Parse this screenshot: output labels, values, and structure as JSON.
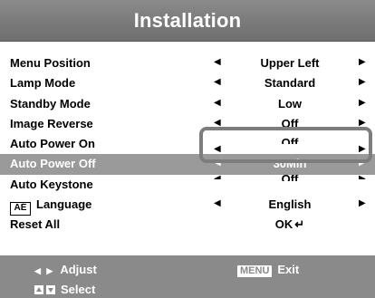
{
  "title": "Installation",
  "menu": {
    "items": [
      {
        "label": "Menu Position",
        "value": "Upper Left"
      },
      {
        "label": "Lamp Mode",
        "value": "Standard"
      },
      {
        "label": "Standby Mode",
        "value": "Low"
      },
      {
        "label": "Image Reverse",
        "value": "Off"
      },
      {
        "label": "Auto Power On",
        "value": "Off"
      },
      {
        "label": "Auto Power Off",
        "value": "30Min"
      },
      {
        "label": "Auto Keystone",
        "value": "Off"
      },
      {
        "label": "Language",
        "value": "English"
      },
      {
        "label": "Reset All",
        "value": "OK"
      }
    ],
    "language_icon_text": "AÉ"
  },
  "footer": {
    "adjust_label": "Adjust",
    "select_label": "Select",
    "menu_key": "MENU",
    "exit_label": "Exit"
  },
  "colors": {
    "title_bar": "#7a7a7a",
    "highlight": "#9a9a9a",
    "footer": "#8a8a8a",
    "value_box_border": "#7d7d7d"
  },
  "icons": [
    "arrow-left-icon",
    "arrow-right-icon",
    "language-icon",
    "enter-icon",
    "up-box-icon",
    "down-box-icon"
  ]
}
